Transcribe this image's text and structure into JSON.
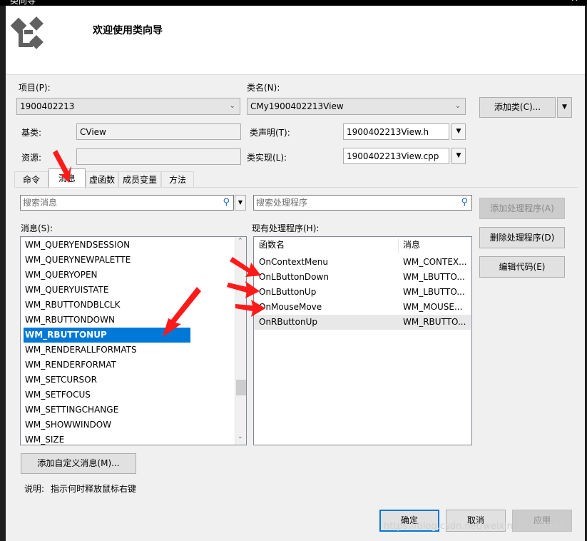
{
  "window": {
    "title_fragment": "类向导",
    "close_glyph": "✕"
  },
  "banner": {
    "title": "欢迎使用类向导",
    "logo_icon": "class-wizard-icon"
  },
  "project": {
    "label": "项目(P):",
    "value": "1900402213"
  },
  "classname": {
    "label": "类名(N):",
    "value": "CMy1900402213View"
  },
  "add_class_button": "添加类(C)...",
  "base_class": {
    "label": "基类:",
    "value": "CView"
  },
  "class_decl": {
    "label": "类声明(T):",
    "value": "1900402213View.h"
  },
  "resource": {
    "label": "资源:",
    "value": ""
  },
  "class_impl": {
    "label": "类实现(L):",
    "value": "1900402213View.cpp"
  },
  "tabs": [
    {
      "label": "命令"
    },
    {
      "label": "消息"
    },
    {
      "label": "虚函数"
    },
    {
      "label": "成员变量"
    },
    {
      "label": "方法"
    }
  ],
  "search_messages": {
    "placeholder": "搜索消息"
  },
  "search_handlers": {
    "placeholder": "搜索处理程序"
  },
  "messages_label": "消息(S):",
  "messages": [
    "WM_QUERYENDSESSION",
    "WM_QUERYNEWPALETTE",
    "WM_QUERYOPEN",
    "WM_QUERYUISTATE",
    "WM_RBUTTONDBLCLK",
    "WM_RBUTTONDOWN",
    "WM_RBUTTONUP",
    "WM_RENDERALLFORMATS",
    "WM_RENDERFORMAT",
    "WM_SETCURSOR",
    "WM_SETFOCUS",
    "WM_SETTINGCHANGE",
    "WM_SHOWWINDOW",
    "WM_SIZE"
  ],
  "selected_message": "WM_RBUTTONUP",
  "handlers_label": "现有处理程序(H):",
  "handlers_columns": [
    "函数名",
    "消息"
  ],
  "handlers": [
    {
      "func": "OnContextMenu",
      "msg": "WM_CONTEX..."
    },
    {
      "func": "OnLButtonDown",
      "msg": "WM_LBUTTO..."
    },
    {
      "func": "OnLButtonUp",
      "msg": "WM_LBUTTO..."
    },
    {
      "func": "OnMouseMove",
      "msg": "WM_MOUSE..."
    },
    {
      "func": "OnRButtonUp",
      "msg": "WM_RBUTTO..."
    }
  ],
  "side_buttons": {
    "add_handler": "添加处理程序(A)",
    "delete_handler": "删除处理程序(D)",
    "edit_code": "编辑代码(E)"
  },
  "add_custom_message_button": "添加自定义消息(M)...",
  "description": {
    "label": "说明:",
    "text": "指示何时释放鼠标右键"
  },
  "footer": {
    "ok": "确定",
    "cancel": "取消",
    "apply": "应用"
  },
  "watermark": "https://blog.csdn.net/weixin_51599044",
  "colors": {
    "selection": "#0078d7",
    "arrow": "#ff1a1a",
    "banner": "#ffffff",
    "dialog": "#f0f0f0"
  }
}
